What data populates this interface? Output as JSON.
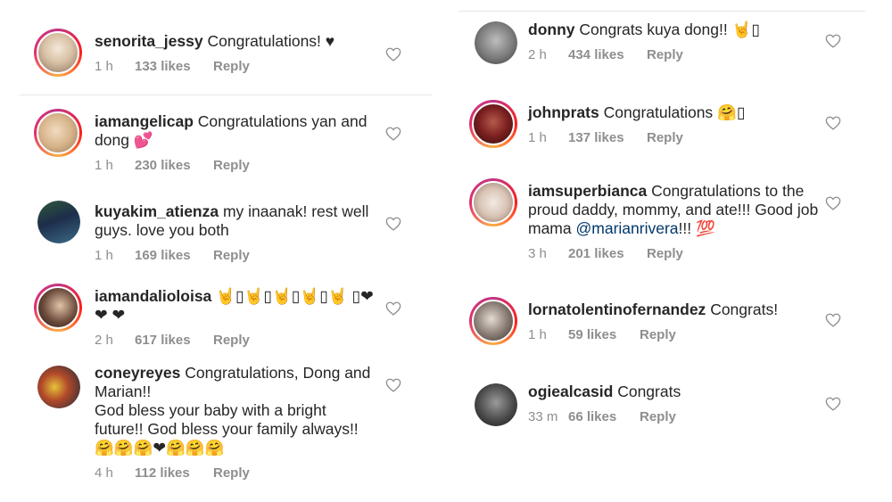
{
  "left_comments": [
    {
      "username": "senorita_jessy",
      "text": "Congratulations! ♥",
      "time": "1 h",
      "likes": "133 likes",
      "reply": "Reply"
    },
    {
      "username": "iamangelicap",
      "text": "Congratulations yan and dong 💕",
      "time": "1 h",
      "likes": "230 likes",
      "reply": "Reply"
    },
    {
      "username": "kuyakim_atienza",
      "text": "my inaanak! rest well guys. love you both",
      "time": "1 h",
      "likes": "169 likes",
      "reply": "Reply"
    },
    {
      "username": "iamandalioloisa",
      "text": "🤘▯🤘▯🤘▯🤘▯🤘 ▯❤ ❤ ❤",
      "time": "2 h",
      "likes": "617 likes",
      "reply": "Reply"
    },
    {
      "username": "coneyreyes",
      "text": "Congratulations, Dong and Marian!!",
      "text2": "God bless your baby with a bright future!! God bless your family always!!",
      "text3": "🤗🤗🤗❤🤗🤗🤗",
      "time": "4 h",
      "likes": "112 likes",
      "reply": "Reply"
    }
  ],
  "right_comments": [
    {
      "username": "donny",
      "text": "Congrats kuya dong!! 🤘▯",
      "time": "2 h",
      "likes": "434 likes",
      "reply": "Reply"
    },
    {
      "username": "johnprats",
      "text": "Congratulations 🤗▯",
      "time": "1 h",
      "likes": "137 likes",
      "reply": "Reply"
    },
    {
      "username": "iamsuperbianca",
      "text": "Congratulations to the proud daddy, mommy, and ate!!! Good job mama",
      "mention": "@marianrivera",
      "text_after": "!!! 💯",
      "time": "3 h",
      "likes": "201 likes",
      "reply": "Reply"
    },
    {
      "username": "lornatolentinofernandez",
      "text": "Congrats!",
      "time": "1 h",
      "likes": "59 likes",
      "reply": "Reply"
    },
    {
      "username": "ogiealcasid",
      "text": "Congrats",
      "time": "33 m",
      "likes": "66 likes",
      "reply": "Reply"
    }
  ],
  "colors": {
    "username": "#262626",
    "meta": "#8e8e8e",
    "mention": "#00376b",
    "divider": "#e6e6e6"
  },
  "icons": {
    "like": "heart-outline-icon"
  }
}
